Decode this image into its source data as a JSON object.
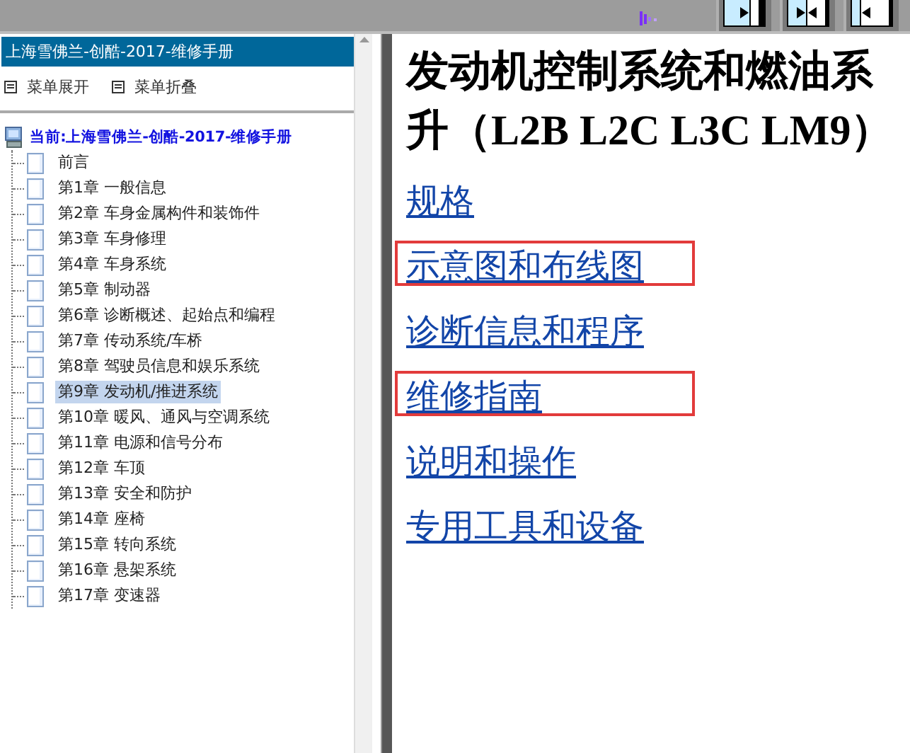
{
  "sidebar": {
    "title": "上海雪佛兰-创酷-2017-维修手册",
    "actions": [
      {
        "label": "菜单展开"
      },
      {
        "label": "菜单折叠"
      }
    ],
    "tree": {
      "label": "当前:上海雪佛兰-创酷-2017-维修手册",
      "children": [
        {
          "label": "前言",
          "selected": false
        },
        {
          "label": "第1章 一般信息",
          "selected": false
        },
        {
          "label": "第2章 车身金属构件和装饰件",
          "selected": false
        },
        {
          "label": "第3章 车身修理",
          "selected": false
        },
        {
          "label": "第4章 车身系统",
          "selected": false
        },
        {
          "label": "第5章 制动器",
          "selected": false
        },
        {
          "label": "第6章 诊断概述、起始点和编程",
          "selected": false
        },
        {
          "label": "第7章 传动系统/车桥",
          "selected": false
        },
        {
          "label": "第8章 驾驶员信息和娱乐系统",
          "selected": false
        },
        {
          "label": "第9章 发动机/推进系统",
          "selected": true
        },
        {
          "label": "第10章 暖风、通风与空调系统",
          "selected": false
        },
        {
          "label": "第11章 电源和信号分布",
          "selected": false
        },
        {
          "label": "第12章 车顶",
          "selected": false
        },
        {
          "label": "第13章 安全和防护",
          "selected": false
        },
        {
          "label": "第14章 座椅",
          "selected": false
        },
        {
          "label": "第15章 转向系统",
          "selected": false
        },
        {
          "label": "第16章 悬架系统",
          "selected": false
        },
        {
          "label": "第17章 变速器",
          "selected": false
        }
      ]
    }
  },
  "content": {
    "title_lines": [
      "发动机控制系统和燃油系",
      "升（L2B L2C L3C LM9）"
    ],
    "links": [
      {
        "label": "规格",
        "highlighted": false
      },
      {
        "label": "示意图和布线图",
        "highlighted": true
      },
      {
        "label": "诊断信息和程序",
        "highlighted": false
      },
      {
        "label": "维修指南",
        "highlighted": true
      },
      {
        "label": "说明和操作",
        "highlighted": false
      },
      {
        "label": "专用工具和设备",
        "highlighted": false
      }
    ]
  },
  "toolbar": {
    "buttons": [
      {
        "kind": "right"
      },
      {
        "kind": "both"
      },
      {
        "kind": "left"
      }
    ]
  }
}
